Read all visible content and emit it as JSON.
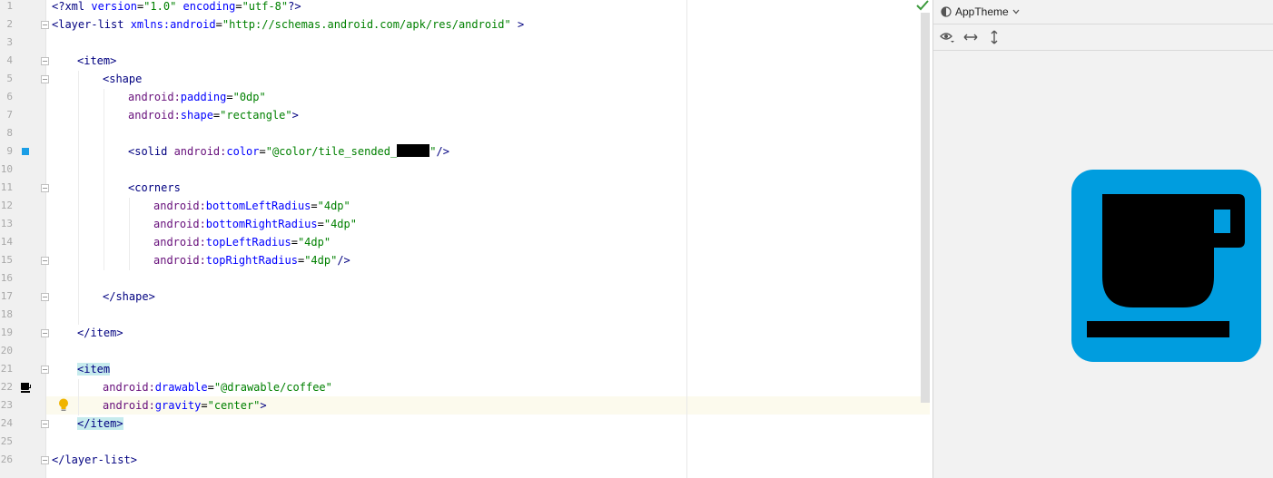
{
  "editor": {
    "line_numbers": [
      "1",
      "2",
      "3",
      "4",
      "5",
      "6",
      "7",
      "8",
      "9",
      "10",
      "11",
      "12",
      "13",
      "14",
      "15",
      "16",
      "17",
      "18",
      "19",
      "20",
      "21",
      "22",
      "23",
      "24",
      "25",
      "26"
    ],
    "lines": {
      "l1": {
        "open": "<?xml ",
        "a1": "version",
        "eq1": "=",
        "v1": "\"1.0\"",
        "sp": " ",
        "a2": "encoding",
        "eq2": "=",
        "v2": "\"utf-8\"",
        "close": "?>"
      },
      "l2": {
        "open": "<layer-list ",
        "ns": "xmlns:",
        "attr": "android",
        "eq": "=",
        "val": "\"http://schemas.android.com/apk/res/android\"",
        "close": " >"
      },
      "l4": {
        "text": "<item>"
      },
      "l5": {
        "text": "<shape"
      },
      "l6": {
        "ns": "android:",
        "attr": "padding",
        "eq": "=",
        "val": "\"0dp\""
      },
      "l7": {
        "ns": "android:",
        "attr": "shape",
        "eq": "=",
        "val": "\"rectangle\"",
        "close": ">"
      },
      "l9": {
        "open": "<solid ",
        "ns": "android:",
        "attr": "color",
        "eq": "=",
        "val": "\"@color/tile_sended_",
        "val_end": "\"",
        "close": "/>"
      },
      "l11": {
        "text": "<corners"
      },
      "l12": {
        "ns": "android:",
        "attr": "bottomLeftRadius",
        "eq": "=",
        "val": "\"4dp\""
      },
      "l13": {
        "ns": "android:",
        "attr": "bottomRightRadius",
        "eq": "=",
        "val": "\"4dp\""
      },
      "l14": {
        "ns": "android:",
        "attr": "topLeftRadius",
        "eq": "=",
        "val": "\"4dp\""
      },
      "l15": {
        "ns": "android:",
        "attr": "topRightRadius",
        "eq": "=",
        "val": "\"4dp\"",
        "close": "/>"
      },
      "l17": {
        "text": "</shape>"
      },
      "l19": {
        "text": "</item>"
      },
      "l21": {
        "text": "<item"
      },
      "l22": {
        "ns": "android:",
        "attr": "drawable",
        "eq": "=",
        "val": "\"@drawable/coffee\""
      },
      "l23": {
        "ns": "android:",
        "attr": "gravity",
        "eq": "=",
        "val": "\"center\"",
        "close": ">"
      },
      "l24": {
        "text": "</item>"
      },
      "l26": {
        "text": "</layer-list>"
      }
    }
  },
  "preview": {
    "theme_label": "AppTheme",
    "icons": [
      "theme-icon",
      "chevron-down-icon",
      "eye-icon",
      "horizontal-resize-icon",
      "vertical-resize-icon",
      "coffee-cup-icon"
    ]
  },
  "colors": {
    "tile": "#009ddf",
    "tag": "#000080",
    "namespace": "#660e7a",
    "attribute": "#0000ff",
    "string": "#008000",
    "gutter_marker": "#1a9ee6"
  }
}
